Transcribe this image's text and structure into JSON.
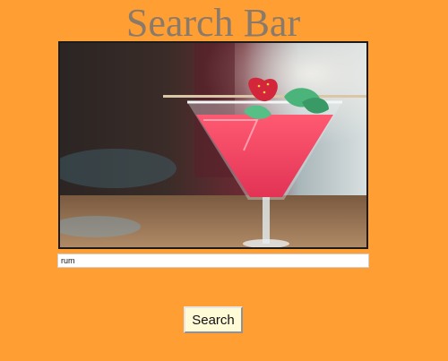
{
  "page": {
    "title": "Search Bar",
    "background_color": "#ff9f33"
  },
  "hero_image": {
    "subject": "cocktail-glass-with-strawberry-and-mint"
  },
  "search": {
    "value": "rum",
    "button_label": "Search"
  }
}
